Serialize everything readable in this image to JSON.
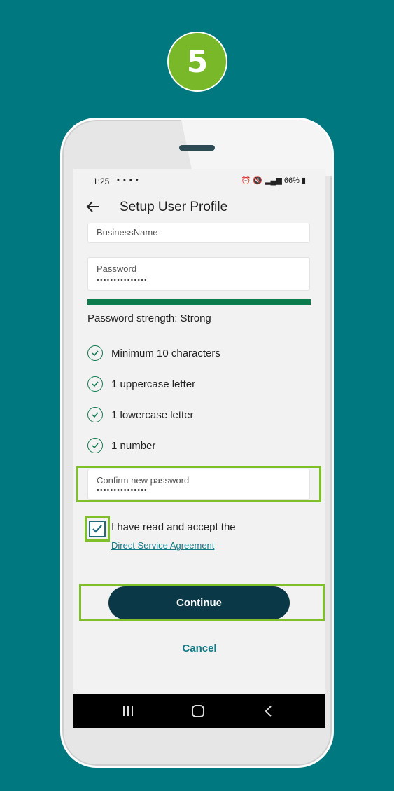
{
  "step_badge": "5",
  "status_bar": {
    "time": "1:25",
    "left_icons": "▪ ▪ ▪ •",
    "right_text": "66%"
  },
  "header": {
    "title": "Setup User Profile"
  },
  "fields": {
    "business_name": {
      "label": "BusinessName",
      "value": ""
    },
    "password": {
      "label": "Password",
      "value": "•••••••••••••••"
    },
    "confirm_password": {
      "label": "Confirm new password",
      "value": "•••••••••••••••"
    }
  },
  "password_strength": "Password strength: Strong",
  "requirements": [
    "Minimum 10 characters",
    "1 uppercase letter",
    "1 lowercase letter",
    "1 number"
  ],
  "agreement": {
    "text": "I have read and accept the",
    "link": "Direct Service Agreement",
    "checked": true
  },
  "buttons": {
    "continue": "Continue",
    "cancel": "Cancel"
  },
  "colors": {
    "background": "#007880",
    "badge": "#79b929",
    "highlight": "#7fbf2a",
    "strength_bar": "#0c7c4c",
    "primary_button": "#0b3846",
    "link": "#137a86"
  }
}
